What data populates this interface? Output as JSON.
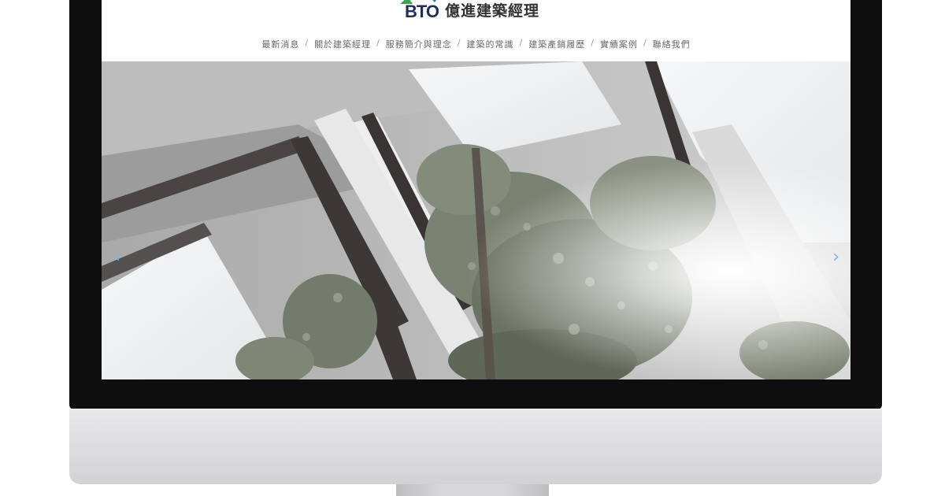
{
  "site": {
    "logo_mark": "BTO",
    "logo_text": "億進建築經理"
  },
  "nav": {
    "items": [
      {
        "label": "最新消息"
      },
      {
        "label": "關於建築經理"
      },
      {
        "label": "服務簡介與理念"
      },
      {
        "label": "建築的常識"
      },
      {
        "label": "建築產銷履歷"
      },
      {
        "label": "實績案例"
      },
      {
        "label": "聯絡我們"
      }
    ],
    "separator": "/"
  },
  "slider": {
    "prev_icon": "chevron-left-icon",
    "next_icon": "chevron-right-icon",
    "prev_glyph": "‹",
    "next_glyph": "›"
  },
  "colors": {
    "logo_navy": "#1f2e5c",
    "logo_green": "#3aa64a",
    "logo_blue": "#2878b8",
    "arrow": "#7fb3d8"
  }
}
